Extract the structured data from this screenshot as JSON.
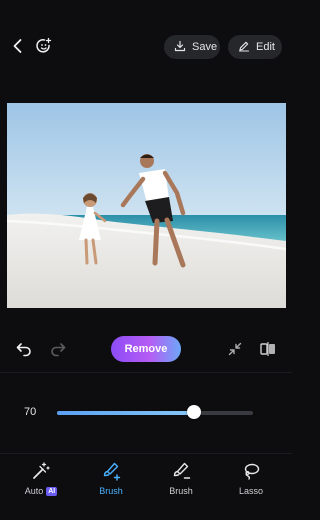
{
  "header": {
    "save_label": "Save",
    "edit_label": "Edit",
    "icons": [
      "back-arrow-icon",
      "sticker-smile-icon",
      "download-icon",
      "pencil-icon"
    ]
  },
  "photo": {
    "description_icon": "beach-photo"
  },
  "actions": {
    "remove_label": "Remove",
    "icons": [
      "undo-icon",
      "redo-icon",
      "minimize-icon",
      "compare-icon"
    ]
  },
  "brush_size": {
    "value": "70",
    "level": 0.7
  },
  "tabs": [
    {
      "label": "Auto",
      "badge": "AI",
      "icon": "magic-wand-icon",
      "active": false
    },
    {
      "label": "Brush",
      "icon": "brush-plus-icon",
      "active": true
    },
    {
      "label": "Brush",
      "icon": "brush-minus-icon",
      "active": false
    },
    {
      "label": "Lasso",
      "icon": "lasso-icon",
      "active": false
    }
  ],
  "colors": {
    "background": "#0d0d0f",
    "pill": "#26272b",
    "accent_blue": "#4ab1ff",
    "remove_gradient_start": "#8d4cf6",
    "remove_gradient_end": "#6da7f7"
  }
}
